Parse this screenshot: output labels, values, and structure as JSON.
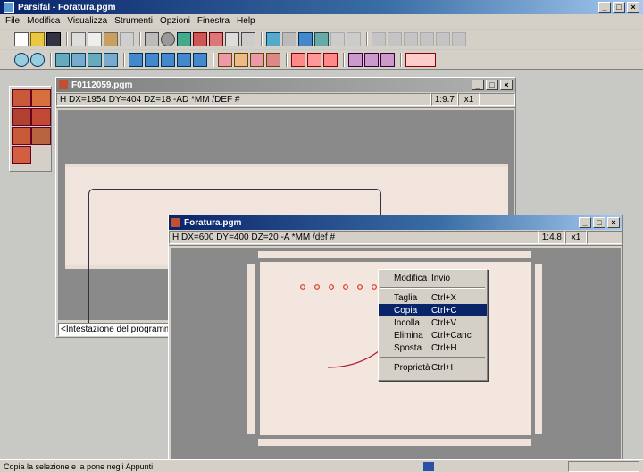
{
  "app": {
    "title": "Parsifal - Foratura.pgm",
    "menu": [
      "File",
      "Modifica",
      "Visualizza",
      "Strumenti",
      "Opzioni",
      "Finestra",
      "Help"
    ],
    "controls": {
      "min": "_",
      "max": "□",
      "close": "×"
    }
  },
  "window_back": {
    "title": "F0112059.pgm",
    "header_line": "H DX=1954 DY=404 DZ=18 -AD *MM /DEF #",
    "scale": "1:9.7",
    "zoom": "x1",
    "status": "<Intestazione del programm"
  },
  "window_front": {
    "title": "Foratura.pgm",
    "header_line": "H DX=600 DY=400 DZ=20 -A *MM /def #",
    "scale": "1:4.8",
    "zoom": "x1"
  },
  "context_menu": {
    "items": [
      {
        "label": "Modifica",
        "shortcut": "Invio"
      },
      {
        "label": "Taglia",
        "shortcut": "Ctrl+X"
      },
      {
        "label": "Copia",
        "shortcut": "Ctrl+C",
        "selected": true
      },
      {
        "label": "Incolla",
        "shortcut": "Ctrl+V"
      },
      {
        "label": "Elimina",
        "shortcut": "Ctrl+Canc"
      },
      {
        "label": "Sposta",
        "shortcut": "Ctrl+H"
      },
      {
        "label": "Proprietà",
        "shortcut": "Ctrl+I"
      }
    ]
  },
  "statusbar": {
    "text": "Copia la selezione e la pone negli Appunti"
  },
  "colors": {
    "accent": "#0a246a",
    "panel": "#f0e4dc",
    "workspace": "#8a8a8a"
  }
}
